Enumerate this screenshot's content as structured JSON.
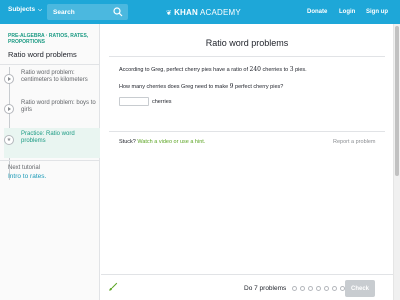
{
  "header": {
    "subjects_label": "Subjects",
    "search_placeholder": "Search",
    "logo_text_bold": "KHAN",
    "logo_text": "ACADEMY",
    "donate": "Donate",
    "login": "Login",
    "signup": "Sign up",
    "brand_color": "#1ea7d8"
  },
  "sidebar": {
    "breadcrumb": "PRE-ALGEBRA · RATIOS, RATES, PROPORTIONS",
    "title": "Ratio word problems",
    "tasks": [
      {
        "label": "Ratio word problem: centimeters to kilometers",
        "icon": "play-icon",
        "active": false
      },
      {
        "label": "Ratio word problem: boys to girls",
        "icon": "play-icon",
        "active": false
      },
      {
        "label": "Practice: Ratio word problems",
        "icon": "star-icon",
        "active": true
      }
    ],
    "next_label": "Next tutorial",
    "next_link": "Intro to rates."
  },
  "exercise": {
    "title": "Ratio word problems",
    "problem_pre": "According to Greg, perfect cherry pies have a ratio of ",
    "problem_num1": "240",
    "problem_mid": " cherries to ",
    "problem_num2": "3",
    "problem_post": " pies.",
    "question_pre": "How many cherries does Greg need to make ",
    "question_num": "9",
    "question_post": " perfect cherry pies?",
    "answer_value": "",
    "answer_unit": "cherries",
    "stuck_label": "Stuck?",
    "stuck_link": "Watch a video or use a hint.",
    "report": "Report a problem"
  },
  "footer": {
    "do_text": "Do 7 problems",
    "progress_total": 7,
    "progress_done": 0,
    "check_label": "Check"
  }
}
